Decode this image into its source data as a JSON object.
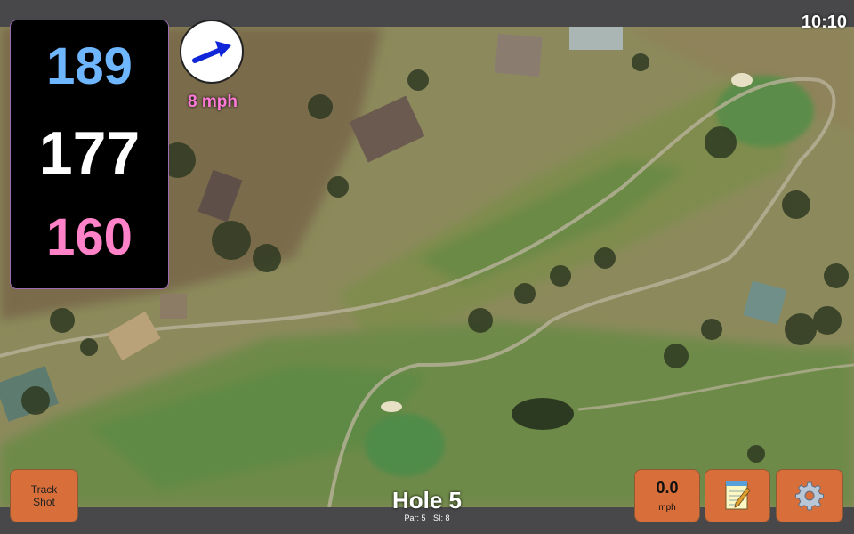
{
  "status": {
    "time": "10:10"
  },
  "distances": {
    "back": "189",
    "middle": "177",
    "front": "160",
    "colors": {
      "back": "#6eb6ff",
      "middle": "#ffffff",
      "front": "#ff82c8"
    }
  },
  "wind": {
    "speed_label": "8 mph",
    "direction_icon": "arrow-icon",
    "color": "#ff7ad9",
    "arrow_color": "#1026d8"
  },
  "buttons": {
    "track_shot": {
      "line1": "Track",
      "line2": "Shot"
    },
    "speed": {
      "value": "0.0",
      "unit": "mph"
    },
    "notes": {
      "icon": "notepad-icon"
    },
    "settings": {
      "icon": "gear-icon"
    },
    "color": "#d86f3b"
  },
  "hole": {
    "title": "Hole 5",
    "par_label": "Par: 5",
    "si_label": "SI: 8"
  }
}
